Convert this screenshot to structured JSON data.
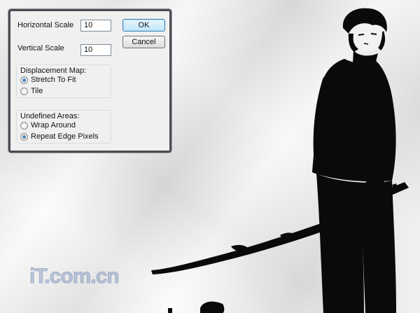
{
  "dialog": {
    "horizontal_scale": {
      "label": "Horizontal Scale",
      "value": "10"
    },
    "vertical_scale": {
      "label": "Vertical Scale",
      "value": "10"
    },
    "ok_label": "OK",
    "cancel_label": "Cancel",
    "displacement_map": {
      "title": "Displacement Map:",
      "options": [
        {
          "label": "Stretch To Fit",
          "checked": true
        },
        {
          "label": "Tile",
          "checked": false
        }
      ]
    },
    "undefined_areas": {
      "title": "Undefined Areas:",
      "options": [
        {
          "label": "Wrap Around",
          "checked": false
        },
        {
          "label": "Repeat Edge Pixels",
          "checked": true
        }
      ]
    }
  },
  "watermark": {
    "text": "iT.com.cn"
  },
  "colors": {
    "silhouette": "#0a0a0a",
    "paper": "#e6e6e6",
    "dialog_border": "#4a4d52"
  }
}
